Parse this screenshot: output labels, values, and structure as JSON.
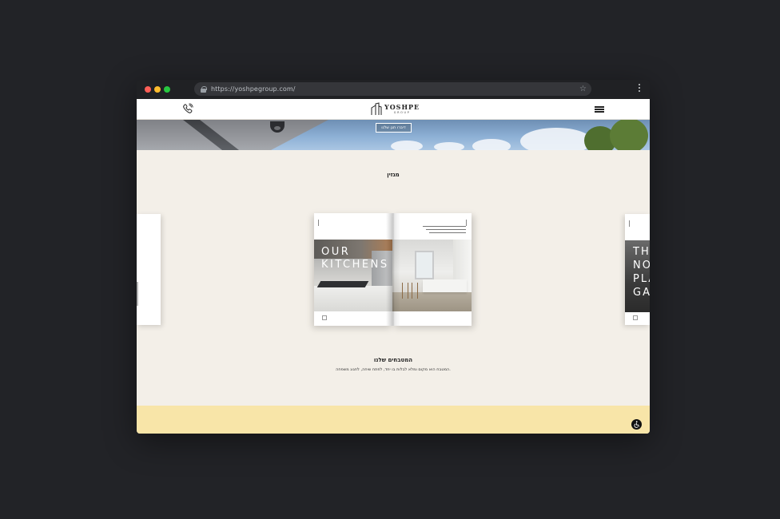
{
  "browser": {
    "url": "https://yoshpegroup.com/",
    "star_icon": "star-icon",
    "menu_icon": "kebab-menu-icon"
  },
  "header": {
    "logo_title": "YOSHPE",
    "logo_subtitle": "GROUP",
    "phone_icon": "phone-icon",
    "menu_icon": "hamburger-icon"
  },
  "hero": {
    "button_label": "דיברו תגן שלנו"
  },
  "magazine": {
    "section_title": "מגזין",
    "left_page_title_line1": "OUR",
    "left_page_title_line2": "KITCHENS",
    "next_slide_lines": [
      "THE",
      "NO",
      "PLA",
      "GA"
    ]
  },
  "kitchens": {
    "title": "המטבחים שלנו",
    "description": "המטבח הוא מקום ומלא לבלות בו יחד, לפתח שיחה, לחגוג משפחה."
  },
  "accessibility": {
    "icon": "accessibility-icon"
  },
  "colors": {
    "page_bg": "#f3efe8",
    "footer_band": "#f8e5a8",
    "desktop_bg": "#222327"
  }
}
